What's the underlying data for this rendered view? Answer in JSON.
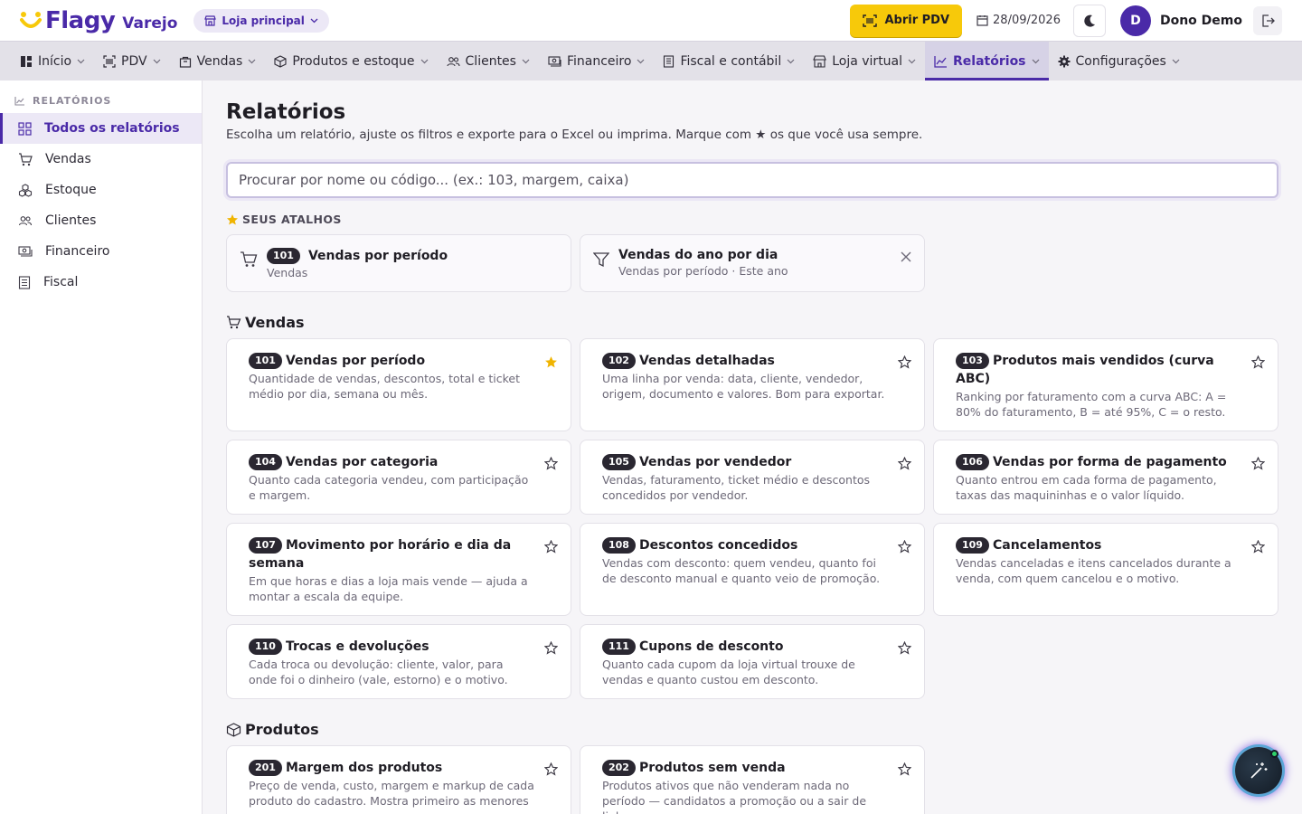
{
  "brand": {
    "name": "Flagy",
    "sub": "Varejo"
  },
  "store": {
    "label": "Loja principal"
  },
  "header": {
    "pdv_label": "Abrir PDV",
    "date": "28/09/2026",
    "user_initial": "D",
    "user_name": "Dono Demo"
  },
  "nav": [
    {
      "label": "Início",
      "icon": "grid-icon"
    },
    {
      "label": "PDV",
      "icon": "barcode-icon"
    },
    {
      "label": "Vendas",
      "icon": "bag-icon"
    },
    {
      "label": "Produtos e estoque",
      "icon": "box-icon"
    },
    {
      "label": "Clientes",
      "icon": "users-icon"
    },
    {
      "label": "Financeiro",
      "icon": "money-icon"
    },
    {
      "label": "Fiscal e contábil",
      "icon": "document-icon"
    },
    {
      "label": "Loja virtual",
      "icon": "store-icon"
    },
    {
      "label": "Relatórios",
      "icon": "chart-icon",
      "active": true
    },
    {
      "label": "Configurações",
      "icon": "gear-icon"
    }
  ],
  "sidebar": {
    "heading": "RELATÓRIOS",
    "items": [
      {
        "label": "Todos os relatórios",
        "icon": "grid-icon",
        "active": true
      },
      {
        "label": "Vendas",
        "icon": "cart-icon"
      },
      {
        "label": "Estoque",
        "icon": "boxes-icon"
      },
      {
        "label": "Clientes",
        "icon": "users-icon"
      },
      {
        "label": "Financeiro",
        "icon": "money-icon"
      },
      {
        "label": "Fiscal",
        "icon": "document-icon"
      }
    ]
  },
  "page": {
    "title": "Relatórios",
    "subtitle": "Escolha um relatório, ajuste os filtros e exporte para o Excel ou imprima. Marque com ★ os que você usa sempre.",
    "search_placeholder": "Procurar por nome ou código... (ex.: 103, margem, caixa)"
  },
  "shortcuts": {
    "heading": "SEUS ATALHOS",
    "items": [
      {
        "code": "101",
        "title": "Vendas por período",
        "sub": "Vendas"
      },
      {
        "title": "Vendas do ano por dia",
        "sub": "Vendas por período · Este ano"
      }
    ]
  },
  "groups": {
    "vendas": {
      "title": "Vendas",
      "cards": [
        {
          "code": "101",
          "title": "Vendas por período",
          "desc": "Quantidade de vendas, descontos, total e ticket médio por dia, semana ou mês.",
          "starred": true
        },
        {
          "code": "102",
          "title": "Vendas detalhadas",
          "desc": "Uma linha por venda: data, cliente, vendedor, origem, documento e valores. Bom para exportar."
        },
        {
          "code": "103",
          "title": "Produtos mais vendidos (curva ABC)",
          "desc": "Ranking por faturamento com a curva ABC: A = 80% do faturamento, B = até 95%, C = o resto."
        },
        {
          "code": "104",
          "title": "Vendas por categoria",
          "desc": "Quanto cada categoria vendeu, com participação e margem."
        },
        {
          "code": "105",
          "title": "Vendas por vendedor",
          "desc": "Vendas, faturamento, ticket médio e descontos concedidos por vendedor."
        },
        {
          "code": "106",
          "title": "Vendas por forma de pagamento",
          "desc": "Quanto entrou em cada forma de pagamento, taxas das maquininhas e o valor líquido."
        },
        {
          "code": "107",
          "title": "Movimento por horário e dia da semana",
          "desc": "Em que horas e dias a loja mais vende — ajuda a montar a escala da equipe."
        },
        {
          "code": "108",
          "title": "Descontos concedidos",
          "desc": "Vendas com desconto: quem vendeu, quanto foi de desconto manual e quanto veio de promoção."
        },
        {
          "code": "109",
          "title": "Cancelamentos",
          "desc": "Vendas canceladas e itens cancelados durante a venda, com quem cancelou e o motivo."
        },
        {
          "code": "110",
          "title": "Trocas e devoluções",
          "desc": "Cada troca ou devolução: cliente, valor, para onde foi o dinheiro (vale, estorno) e o motivo."
        },
        {
          "code": "111",
          "title": "Cupons de desconto",
          "desc": "Quanto cada cupom da loja virtual trouxe de vendas e quanto custou em desconto."
        }
      ]
    },
    "produtos": {
      "title": "Produtos",
      "cards": [
        {
          "code": "201",
          "title": "Margem dos produtos",
          "desc": "Preço de venda, custo, margem e markup de cada produto do cadastro. Mostra primeiro as menores margens."
        },
        {
          "code": "202",
          "title": "Produtos sem venda",
          "desc": "Produtos ativos que não venderam nada no período — candidatos a promoção ou a sair de linha."
        }
      ]
    }
  },
  "colors": {
    "primary": "#4a2aa8",
    "accent": "#f7c90a",
    "star": "#f0b400"
  }
}
